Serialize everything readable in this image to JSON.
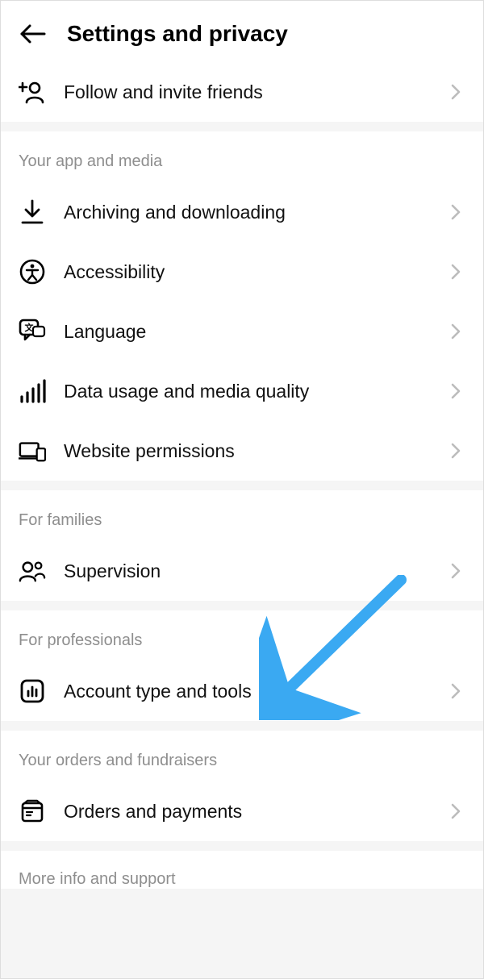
{
  "header": {
    "title": "Settings and privacy"
  },
  "top_row": {
    "label": "Follow and invite friends"
  },
  "sections": {
    "app_media": {
      "title": "Your app and media",
      "items": [
        {
          "label": "Archiving and downloading"
        },
        {
          "label": "Accessibility"
        },
        {
          "label": "Language"
        },
        {
          "label": "Data usage and media quality"
        },
        {
          "label": "Website permissions"
        }
      ]
    },
    "families": {
      "title": "For families",
      "items": [
        {
          "label": "Supervision"
        }
      ]
    },
    "professionals": {
      "title": "For professionals",
      "items": [
        {
          "label": "Account type and tools"
        }
      ]
    },
    "orders": {
      "title": "Your orders and fundraisers",
      "items": [
        {
          "label": "Orders and payments"
        }
      ]
    },
    "more": {
      "title": "More info and support"
    }
  },
  "annotation": {
    "arrow_color": "#3aa9f2"
  }
}
